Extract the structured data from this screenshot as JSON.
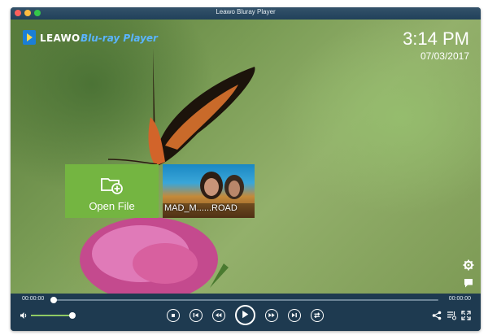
{
  "window": {
    "title": "Leawo Bluray Player"
  },
  "logo": {
    "brand": "LEAWO",
    "product": "Blu-ray Player"
  },
  "clock": {
    "time": "3:14 PM",
    "date": "07/03/2017"
  },
  "tiles": {
    "open_file": {
      "label": "Open File",
      "icon": "folder-plus-icon"
    },
    "media": {
      "label": "MAD_M......ROAD"
    }
  },
  "side_icons": [
    "settings-gear-icon",
    "chat-bubble-icon"
  ],
  "player": {
    "elapsed": "00:00:00",
    "total": "00:00:00",
    "progress": 0,
    "volume": 0.95,
    "controls": [
      "stop",
      "previous",
      "rewind",
      "play",
      "fast-forward",
      "next",
      "playlist"
    ],
    "right_controls": [
      "share-icon",
      "playlist-settings-icon",
      "fullscreen-icon"
    ]
  },
  "colors": {
    "accent_green": "#74b541",
    "bar": "#1e3a50",
    "volume": "#8fc964"
  }
}
